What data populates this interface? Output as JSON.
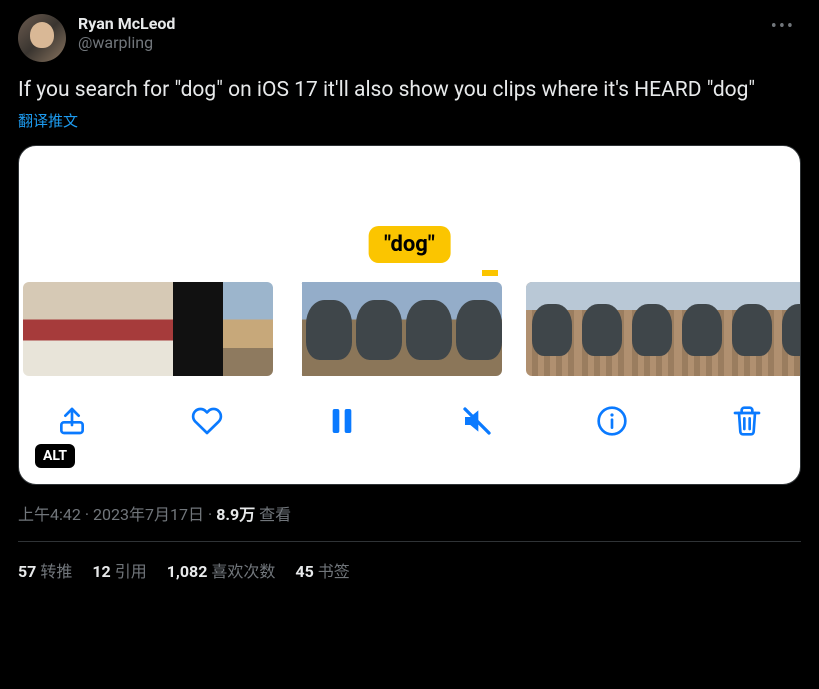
{
  "author": {
    "display_name": "Ryan McLeod",
    "handle": "@warpling"
  },
  "tweet": {
    "text": "If you search for \"dog\" on iOS 17 it'll also show you clips where it's HEARD \"dog\"",
    "translate_label": "翻译推文"
  },
  "media": {
    "badge": "\"dog\"",
    "alt_label": "ALT",
    "controls": {
      "share": "share",
      "like": "like",
      "pause": "pause",
      "mute": "mute",
      "info": "info",
      "trash": "trash"
    }
  },
  "meta": {
    "time": "上午4:42",
    "date": "2023年7月17日",
    "views_count": "8.9万",
    "views_label": "查看"
  },
  "stats": {
    "retweets_count": "57",
    "retweets_label": "转推",
    "quotes_count": "12",
    "quotes_label": "引用",
    "likes_count": "1,082",
    "likes_label": "喜欢次数",
    "bookmarks_count": "45",
    "bookmarks_label": "书签"
  }
}
